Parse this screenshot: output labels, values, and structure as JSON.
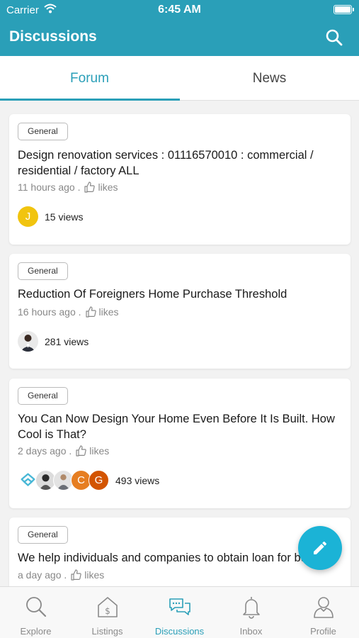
{
  "status_bar": {
    "carrier": "Carrier",
    "time": "6:45 AM"
  },
  "header": {
    "title": "Discussions"
  },
  "tabs": [
    {
      "label": "Forum",
      "active": true
    },
    {
      "label": "News",
      "active": false
    }
  ],
  "posts": [
    {
      "category": "General",
      "title": "Design renovation services : 01116570010 : commercial / residential / factory ALL",
      "time_ago": "11 hours ago .",
      "likes_label": "likes",
      "views": "15 views",
      "avatars": [
        {
          "initial": "J",
          "color": "#f1c40f"
        }
      ]
    },
    {
      "category": "General",
      "title": "Reduction Of Foreigners Home Purchase Threshold",
      "time_ago": "16 hours ago .",
      "likes_label": "likes",
      "views": "281 views"
    },
    {
      "category": "General",
      "title": "You Can Now Design Your Home Even Before It Is Built. How Cool is That?",
      "time_ago": "2 days ago .",
      "likes_label": "likes",
      "views": "493 views",
      "avatars": [
        {
          "initial": "",
          "color": "#ffffff"
        },
        {
          "initial": "",
          "color": "#ffffff"
        },
        {
          "initial": "",
          "color": "#ffffff"
        },
        {
          "initial": "C",
          "color": "#e67e22"
        },
        {
          "initial": "G",
          "color": "#d35400"
        }
      ]
    },
    {
      "category": "General",
      "title": "We help individuals and companies to obtain loan for bu",
      "title_tail": "s",
      "time_ago": "a day ago .",
      "likes_label": "likes"
    }
  ],
  "bottom_nav": [
    {
      "label": "Explore",
      "icon": "search-icon",
      "active": false
    },
    {
      "label": "Listings",
      "icon": "listings-icon",
      "active": false
    },
    {
      "label": "Discussions",
      "icon": "chat-bubbles-icon",
      "active": true
    },
    {
      "label": "Inbox",
      "icon": "bell-icon",
      "active": false
    },
    {
      "label": "Profile",
      "icon": "person-icon",
      "active": false
    }
  ],
  "colors": {
    "brand": "#2a9fb8",
    "fab": "#1bb3d6"
  }
}
